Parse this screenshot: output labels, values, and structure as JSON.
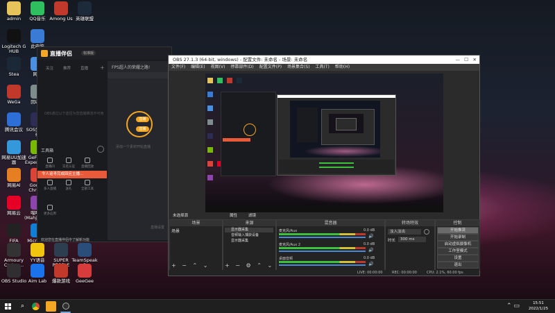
{
  "desktop": {
    "icons": [
      {
        "label": "admin",
        "color": "#e8c35a"
      },
      {
        "label": "QQ音乐",
        "color": "#2fbf5f"
      },
      {
        "label": "Among Us",
        "color": "#c0392b"
      },
      {
        "label": "英雄联盟",
        "color": "#1c2a3a"
      },
      {
        "label": "Logitech G HUB",
        "color": "#111111"
      },
      {
        "label": "此电脑",
        "color": "#3a7bd5"
      },
      {
        "label": "Stea",
        "color": "#1b2838"
      },
      {
        "label": "网络",
        "color": "#4a90e2"
      },
      {
        "label": "WeGa",
        "color": "#c0392b"
      },
      {
        "label": "回收站",
        "color": "#7f8c8d"
      },
      {
        "label": "腾讯会议",
        "color": "#2d6fd6"
      },
      {
        "label": "SOS剑侠传奇",
        "color": "#2c2c54"
      },
      {
        "label": "网易UU加速器",
        "color": "#3498db"
      },
      {
        "label": "GeForce Experience",
        "color": "#76b900"
      },
      {
        "label": "网易Al",
        "color": "#e67e22"
      },
      {
        "label": "Google Chrome",
        "color": "#db4437"
      },
      {
        "label": "网易云",
        "color": "#e60026"
      },
      {
        "label": "喵喵机 (Mahjong-...",
        "color": "#8e44ad"
      },
      {
        "label": "FIFA",
        "color": "#222222"
      },
      {
        "label": "Microsoft Edge",
        "color": "#0f7fd6"
      },
      {
        "label": "Armoury Crate -...",
        "color": "#333333"
      },
      {
        "label": "YY语音",
        "color": "#f1c40f"
      },
      {
        "label": "SUPER PEOPLE CBT",
        "color": "#2c3e50"
      },
      {
        "label": "TeamSpeak 3",
        "color": "#2a4d7a"
      },
      {
        "label": "OBS Studio",
        "color": "#302e31"
      },
      {
        "label": "Aim Lab",
        "color": "#1a73e8"
      },
      {
        "label": "爆款游戏",
        "color": "#c0392b"
      },
      {
        "label": "GeeGee",
        "color": "#d63c3c"
      }
    ]
  },
  "assistant": {
    "title": "直播伴侣",
    "version_badge": "标准版",
    "tabs": [
      "关注",
      "推荐",
      "直播"
    ],
    "tip": "FPS超人的荣耀之路!",
    "placeholder_text": "OBS通过以下途径为您直播推流不可用",
    "tools_title": "工具箱",
    "tool_labels": [
      "直播间",
      "实名认证",
      "直播回放",
      "多人直播",
      "送礼",
      "全部工具",
      "更多应用"
    ],
    "toast": "令人追寻完成回应主播...",
    "bottom_banner": "欢迎您在直播伴侣中了解新功能",
    "center_pill_1": "直播",
    "center_pill_2": "直播",
    "center_caption": "添加一个素材开始直播",
    "right_label": "直播设置"
  },
  "obs": {
    "title": "OBS 27.1.3 (64-bit, windows) - 配置文件: 未命名 - 场景: 未命名",
    "menu": [
      "文件(F)",
      "编辑(E)",
      "视图(V)",
      "停靠部件(D)",
      "配置文件(P)",
      "场景集合(S)",
      "工具(T)",
      "帮助(H)"
    ],
    "panel_bar": [
      "未选择源",
      "属性",
      "滤镜"
    ],
    "docks": {
      "scenes": {
        "title": "场景",
        "items": [
          "场景"
        ]
      },
      "sources": {
        "title": "来源",
        "items": [
          "显示器采集",
          "音频输入捕获设备",
          "显示器采集"
        ]
      },
      "mixer": {
        "title": "混音器",
        "channels": [
          {
            "name": "麦克风/Aux",
            "db": "0.0 dB"
          },
          {
            "name": "麦克风/Aux 2",
            "db": "0.0 dB"
          },
          {
            "name": "桌面音频",
            "db": "0.0 dB"
          }
        ]
      },
      "transitions": {
        "title": "转场特效",
        "type": "淡入淡出",
        "duration_label": "时长",
        "duration": "300 ms"
      },
      "controls": {
        "title": "控制",
        "buttons": [
          "开始推流",
          "开始录制",
          "启动虚拟摄像机",
          "工作室模式",
          "设置",
          "退出"
        ]
      }
    },
    "status": {
      "live": "LIVE: 00:00:00",
      "rec": "REC: 00:00:00",
      "cpu": "CPU: 2.1%, 60.00 fps"
    }
  },
  "taskbar": {
    "time": "15:51",
    "date": "2022/1/25",
    "apps": [
      "start-icon",
      "search-icon",
      "taskview-icon",
      "chrome-icon",
      "assistant-icon",
      "obs-icon"
    ]
  },
  "colors": {
    "accent_orange": "#f5a623",
    "obs_green": "#3ec13e",
    "obs_yellow": "#d6c23a",
    "toast_red": "#e85a3a"
  }
}
